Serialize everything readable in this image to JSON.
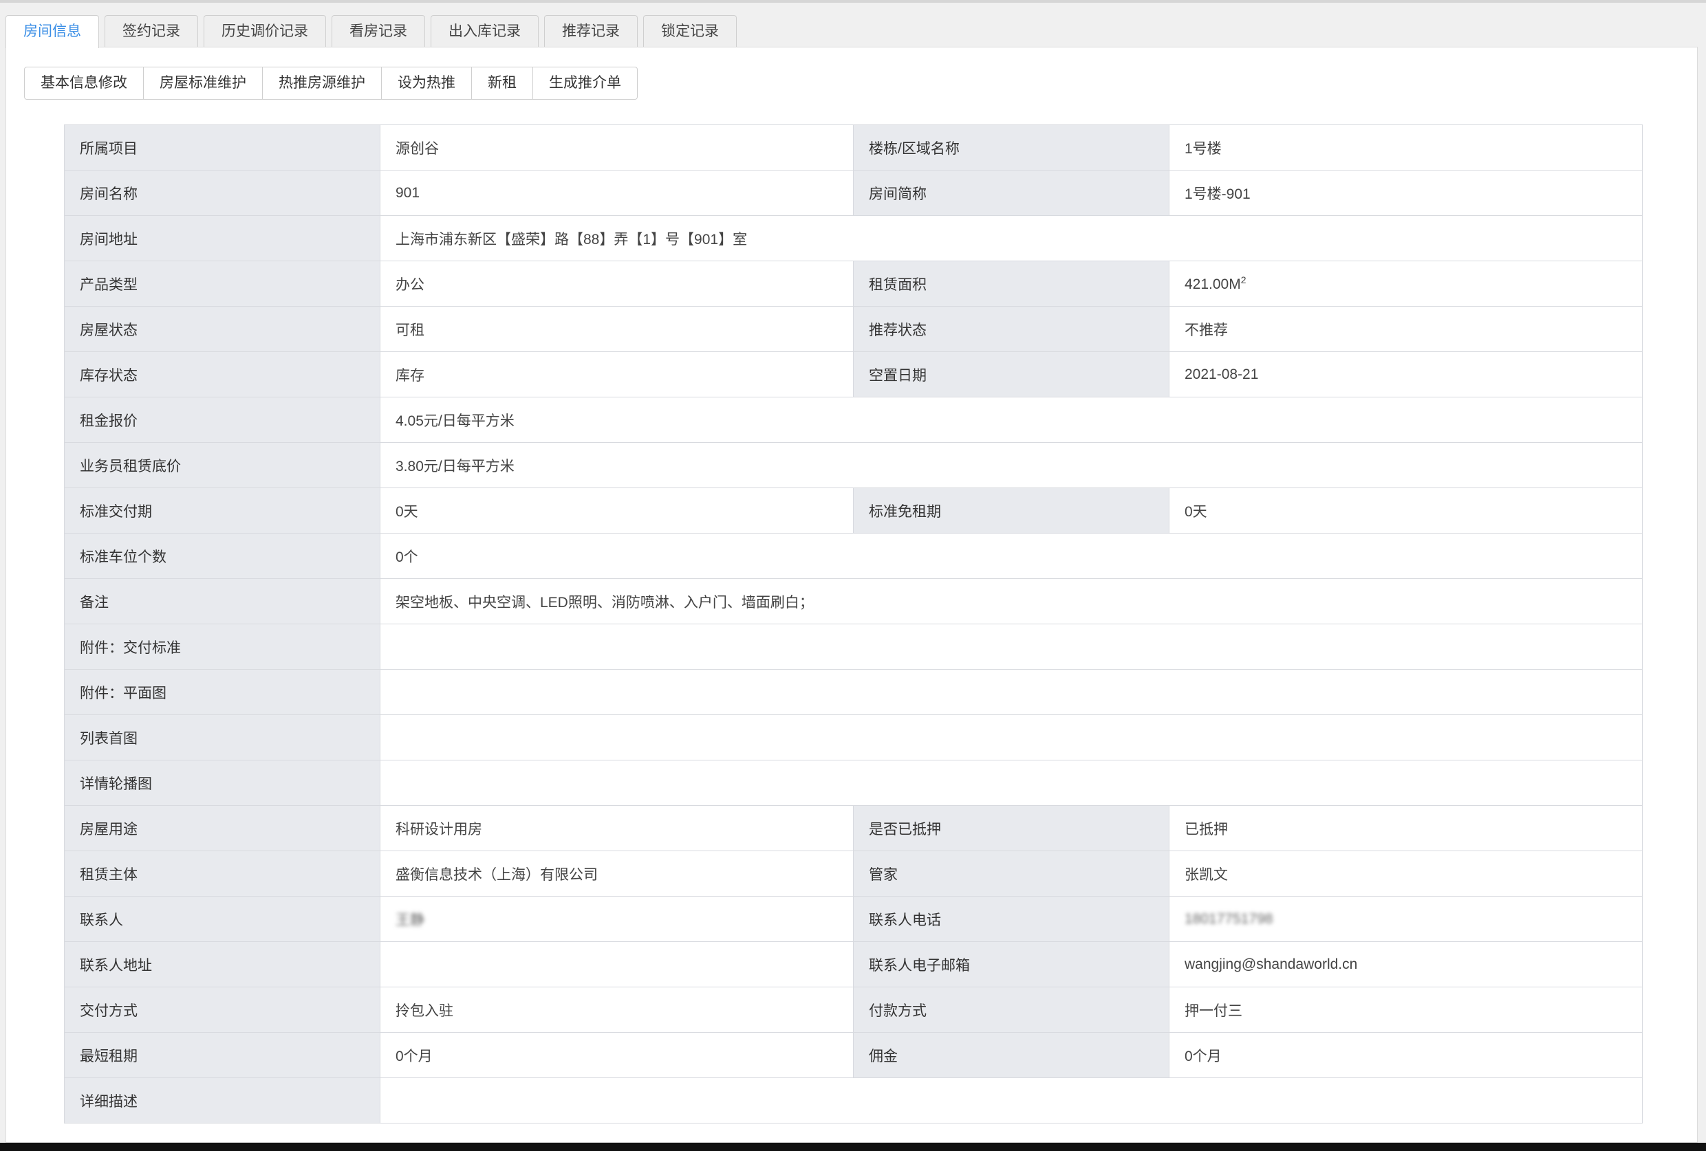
{
  "tabs": [
    {
      "label": "房间信息",
      "active": true
    },
    {
      "label": "签约记录"
    },
    {
      "label": "历史调价记录"
    },
    {
      "label": "看房记录"
    },
    {
      "label": "出入库记录"
    },
    {
      "label": "推荐记录"
    },
    {
      "label": "锁定记录"
    }
  ],
  "toolbar": {
    "basic_edit": "基本信息修改",
    "standard_maintain": "房屋标准维护",
    "hot_maintain": "热推房源维护",
    "set_hot": "设为热推",
    "new_rent": "新租",
    "gen_sheet": "生成推介单"
  },
  "fields": {
    "project": {
      "label": "所属项目",
      "value": "源创谷"
    },
    "building": {
      "label": "楼栋/区域名称",
      "value": "1号楼"
    },
    "room_name": {
      "label": "房间名称",
      "value": "901"
    },
    "room_short": {
      "label": "房间简称",
      "value": "1号楼-901"
    },
    "address": {
      "label": "房间地址",
      "value": "上海市浦东新区【盛荣】路【88】弄【1】号【901】室"
    },
    "product_type": {
      "label": "产品类型",
      "value": "办公"
    },
    "area": {
      "label": "租赁面积",
      "value": "421.00M",
      "sup": "2"
    },
    "house_status": {
      "label": "房屋状态",
      "value": "可租"
    },
    "recommend_status": {
      "label": "推荐状态",
      "value": "不推荐"
    },
    "stock_status": {
      "label": "库存状态",
      "value": "库存"
    },
    "vacant_date": {
      "label": "空置日期",
      "value": "2021-08-21"
    },
    "rent_price": {
      "label": "租金报价",
      "value": "4.05元/日每平方米"
    },
    "floor_price": {
      "label": "业务员租赁底价",
      "value": "3.80元/日每平方米"
    },
    "delivery_period": {
      "label": "标准交付期",
      "value": "0天"
    },
    "free_period": {
      "label": "标准免租期",
      "value": "0天"
    },
    "parking": {
      "label": "标准车位个数",
      "value": "0个"
    },
    "remark": {
      "label": "备注",
      "value": "架空地板、中央空调、LED照明、消防喷淋、入户门、墙面刷白；"
    },
    "attach_standard": {
      "label": "附件：交付标准",
      "value": ""
    },
    "attach_plan": {
      "label": "附件：平面图",
      "value": ""
    },
    "list_image": {
      "label": "列表首图",
      "value": ""
    },
    "carousel": {
      "label": "详情轮播图",
      "value": ""
    },
    "usage": {
      "label": "房屋用途",
      "value": "科研设计用房"
    },
    "mortgaged": {
      "label": "是否已抵押",
      "value": "已抵押"
    },
    "lessor": {
      "label": "租赁主体",
      "value": "盛衡信息技术（上海）有限公司"
    },
    "manager": {
      "label": "管家",
      "value": "张凯文"
    },
    "contact": {
      "label": "联系人",
      "value": "王静"
    },
    "contact_phone": {
      "label": "联系人电话",
      "value": "18017751798"
    },
    "contact_address": {
      "label": "联系人地址",
      "value": ""
    },
    "contact_email": {
      "label": "联系人电子邮箱",
      "value": "wangjing@shandaworld.cn"
    },
    "delivery_method": {
      "label": "交付方式",
      "value": "拎包入驻"
    },
    "payment_method": {
      "label": "付款方式",
      "value": "押一付三"
    },
    "min_term": {
      "label": "最短租期",
      "value": "0个月"
    },
    "commission": {
      "label": "佣金",
      "value": "0个月"
    },
    "detail_desc": {
      "label": "详细描述",
      "value": ""
    }
  }
}
